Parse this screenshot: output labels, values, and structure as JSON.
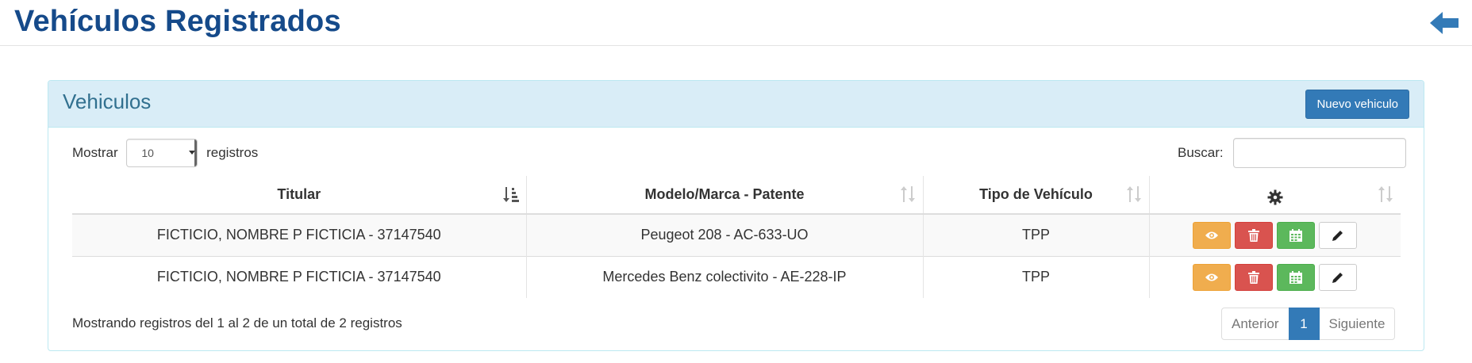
{
  "header": {
    "title": "Vehículos Registrados"
  },
  "panel": {
    "title": "Vehiculos",
    "new_button": "Nuevo vehiculo"
  },
  "length": {
    "prefix": "Mostrar",
    "value": "10",
    "suffix": "registros"
  },
  "search": {
    "label": "Buscar:",
    "value": ""
  },
  "table": {
    "columns": [
      "Titular",
      "Modelo/Marca - Patente",
      "Tipo de Vehículo"
    ],
    "rows": [
      {
        "titular": "FICTICIO, NOMBRE P FICTICIA - 37147540",
        "modelo": "Peugeot 208 - AC-633-UO",
        "tipo": "TPP"
      },
      {
        "titular": "FICTICIO, NOMBRE P FICTICIA - 37147540",
        "modelo": "Mercedes Benz colectivito - AE-228-IP",
        "tipo": "TPP"
      }
    ]
  },
  "footer": {
    "info": "Mostrando registros del 1 al 2 de un total de 2 registros",
    "prev": "Anterior",
    "page": "1",
    "next": "Siguiente"
  },
  "icons": {
    "back": "arrow-left-icon",
    "settings": "gear-icon",
    "view": "eye-icon",
    "delete": "trash-icon",
    "calendar": "calendar-icon",
    "edit": "pencil-icon"
  },
  "colors": {
    "title": "#154a8a",
    "primary": "#337ab7",
    "warning": "#f0ad4e",
    "danger": "#d9534f",
    "success": "#5cb85c",
    "panel_heading": "#d9edf7"
  }
}
